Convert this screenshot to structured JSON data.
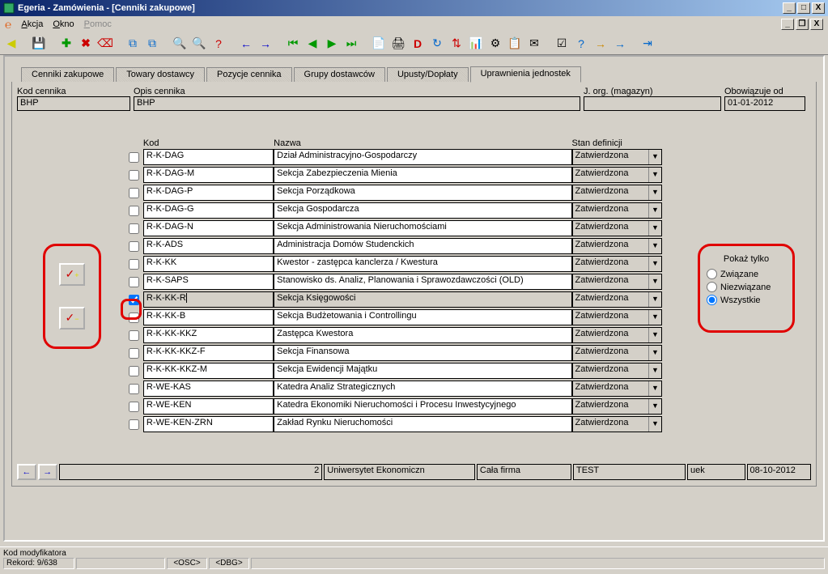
{
  "window": {
    "title": "Egeria - Zamówienia - [Cenniki zakupowe]"
  },
  "menu": {
    "akcja": "Akcja",
    "okno": "Okno",
    "pomoc": "Pomoc"
  },
  "tabs": {
    "t1": "Cenniki zakupowe",
    "t2": "Towary dostawcy",
    "t3": "Pozycje cennika",
    "t4": "Grupy dostawców",
    "t5": "Upusty/Dopłaty",
    "t6": "Uprawnienia jednostek"
  },
  "header": {
    "kod_label": "Kod cennika",
    "kod_value": "BHP",
    "opis_label": "Opis cennika",
    "opis_value": "BHP",
    "jorg_label": "J. org. (magazyn)",
    "jorg_value": "",
    "obow_label": "Obowiązuje od",
    "obow_value": "01-01-2012"
  },
  "grid": {
    "h_kod": "Kod",
    "h_nazwa": "Nazwa",
    "h_stan": "Stan definicji",
    "rows": [
      {
        "chk": false,
        "kod": "R-K-DAG",
        "nazwa": "Dział Administracyjno-Gospodarczy",
        "stan": "Zatwierdzona",
        "sel": false
      },
      {
        "chk": false,
        "kod": "R-K-DAG-M",
        "nazwa": "Sekcja Zabezpieczenia Mienia",
        "stan": "Zatwierdzona",
        "sel": false
      },
      {
        "chk": false,
        "kod": "R-K-DAG-P",
        "nazwa": "Sekcja Porządkowa",
        "stan": "Zatwierdzona",
        "sel": false
      },
      {
        "chk": false,
        "kod": "R-K-DAG-G",
        "nazwa": "Sekcja Gospodarcza",
        "stan": "Zatwierdzona",
        "sel": false
      },
      {
        "chk": false,
        "kod": "R-K-DAG-N",
        "nazwa": "Sekcja Administrowania Nieruchomościami",
        "stan": "Zatwierdzona",
        "sel": false
      },
      {
        "chk": false,
        "kod": "R-K-ADS",
        "nazwa": "Administracja Domów Studenckich",
        "stan": "Zatwierdzona",
        "sel": false
      },
      {
        "chk": false,
        "kod": "R-K-KK",
        "nazwa": "Kwestor - zastępca kanclerza / Kwestura",
        "stan": "Zatwierdzona",
        "sel": false
      },
      {
        "chk": false,
        "kod": "R-K-SAPS",
        "nazwa": "Stanowisko ds. Analiz, Planowania i Sprawozdawczości (OLD)",
        "stan": "Zatwierdzona",
        "sel": false
      },
      {
        "chk": true,
        "kod": "R-K-KK-R",
        "nazwa": "Sekcja Księgowości",
        "stan": "Zatwierdzona",
        "sel": true
      },
      {
        "chk": false,
        "kod": "R-K-KK-B",
        "nazwa": "Sekcja Budżetowania i Controllingu",
        "stan": "Zatwierdzona",
        "sel": false
      },
      {
        "chk": false,
        "kod": "R-K-KK-KKZ",
        "nazwa": "Zastępca Kwestora",
        "stan": "Zatwierdzona",
        "sel": false
      },
      {
        "chk": false,
        "kod": "R-K-KK-KKZ-F",
        "nazwa": "Sekcja Finansowa",
        "stan": "Zatwierdzona",
        "sel": false
      },
      {
        "chk": false,
        "kod": "R-K-KK-KKZ-M",
        "nazwa": "Sekcja Ewidencji Majątku",
        "stan": "Zatwierdzona",
        "sel": false
      },
      {
        "chk": false,
        "kod": "R-WE-KAS",
        "nazwa": "Katedra Analiz Strategicznych",
        "stan": "Zatwierdzona",
        "sel": false
      },
      {
        "chk": false,
        "kod": "R-WE-KEN",
        "nazwa": "Katedra Ekonomiki Nieruchomości i Procesu Inwestycyjnego",
        "stan": "Zatwierdzona",
        "sel": false
      },
      {
        "chk": false,
        "kod": "R-WE-KEN-ZRN",
        "nazwa": "Zakład Rynku Nieruchomości",
        "stan": "Zatwierdzona",
        "sel": false
      }
    ]
  },
  "filter": {
    "title": "Pokaż tylko",
    "r1": "Związane",
    "r2": "Niezwiązane",
    "r3": "Wszystkie",
    "selected": "r3"
  },
  "nav": {
    "num": "2",
    "org": "Uniwersytet Ekonomiczn",
    "firma": "Cała firma",
    "user": "TEST",
    "sys": "uek",
    "date": "08-10-2012"
  },
  "status": {
    "l1": "Kod modyfikatora",
    "rec": "Rekord: 9/638",
    "osc": "<OSC>",
    "dbg": "<DBG>"
  }
}
